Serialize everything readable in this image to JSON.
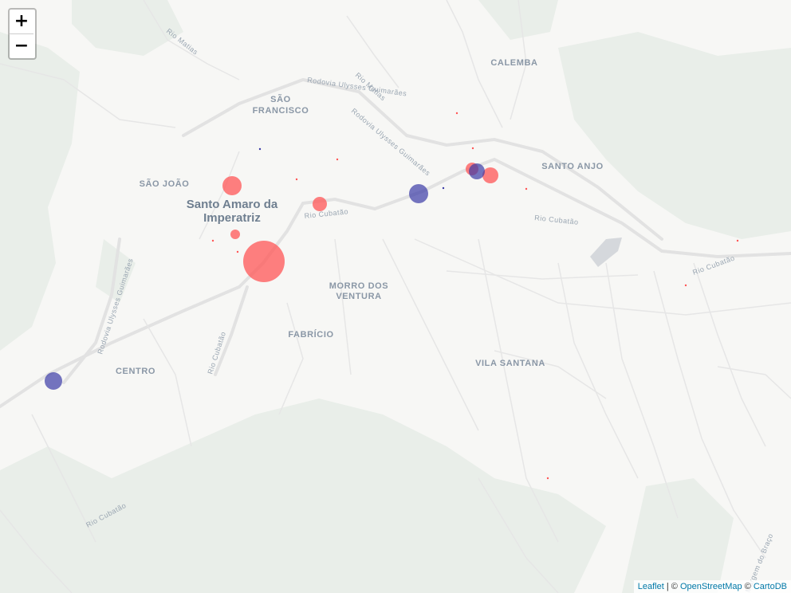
{
  "map": {
    "zoom_in_label": "+",
    "zoom_out_label": "−",
    "places": {
      "calemba": "CALEMBA",
      "sao_francisco_1": "SÃO",
      "sao_francisco_2": "FRANCISCO",
      "santo_anjo": "SANTO ANJO",
      "sao_joao": "SÃO JOÃO",
      "city_1": "Santo Amaro da",
      "city_2": "Imperatriz",
      "morro_1": "MORRO DOS",
      "morro_2": "VENTURA",
      "fabricio": "FABRÍCIO",
      "centro": "CENTRO",
      "vila_santana": "VILA SANTANA"
    },
    "roads": {
      "rio_matias_a": "Rio Matias",
      "rio_matias_b": "Rio Matias",
      "rodovia_a": "Rodovia Ulysses Guimarães",
      "rodovia_b": "Rodovia Ulysses Guimarães",
      "rodovia_c": "Rodovia Ulysses Guimarães",
      "cubatao_a": "Rio Cubatão",
      "cubatao_b": "Rio Cubatão",
      "cubatao_c": "Rio Cubatão",
      "cubatao_d": "Rio Cubatão",
      "cubatao_e": "Rio Cubatão",
      "margem": "Margem do Braço"
    },
    "marker_colors": {
      "red": "#ff5555",
      "blue": "#3a3aa6"
    }
  },
  "attribution": {
    "leaflet": "Leaflet",
    "sep1": " | © ",
    "osm": "OpenStreetMap",
    "sep2": " © ",
    "carto": "CartoDB"
  }
}
